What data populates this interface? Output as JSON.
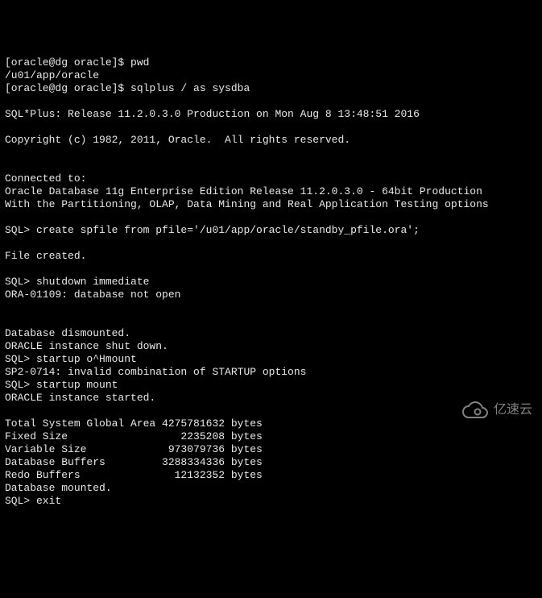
{
  "terminal": {
    "lines": [
      "[oracle@dg oracle]$ pwd",
      "/u01/app/oracle",
      "[oracle@dg oracle]$ sqlplus / as sysdba",
      "",
      "SQL*Plus: Release 11.2.0.3.0 Production on Mon Aug 8 13:48:51 2016",
      "",
      "Copyright (c) 1982, 2011, Oracle.  All rights reserved.",
      "",
      "",
      "Connected to:",
      "Oracle Database 11g Enterprise Edition Release 11.2.0.3.0 - 64bit Production",
      "With the Partitioning, OLAP, Data Mining and Real Application Testing options",
      "",
      "SQL> create spfile from pfile='/u01/app/oracle/standby_pfile.ora';",
      "",
      "File created.",
      "",
      "SQL> shutdown immediate",
      "ORA-01109: database not open",
      "",
      "",
      "Database dismounted.",
      "ORACLE instance shut down.",
      "SQL> startup o^Hmount",
      "SP2-0714: invalid combination of STARTUP options",
      "SQL> startup mount",
      "ORACLE instance started.",
      "",
      "Total System Global Area 4275781632 bytes",
      "Fixed Size                  2235208 bytes",
      "Variable Size             973079736 bytes",
      "Database Buffers         3288334336 bytes",
      "Redo Buffers               12132352 bytes",
      "Database mounted.",
      "SQL> exit"
    ]
  },
  "watermark": {
    "text": "亿速云"
  }
}
